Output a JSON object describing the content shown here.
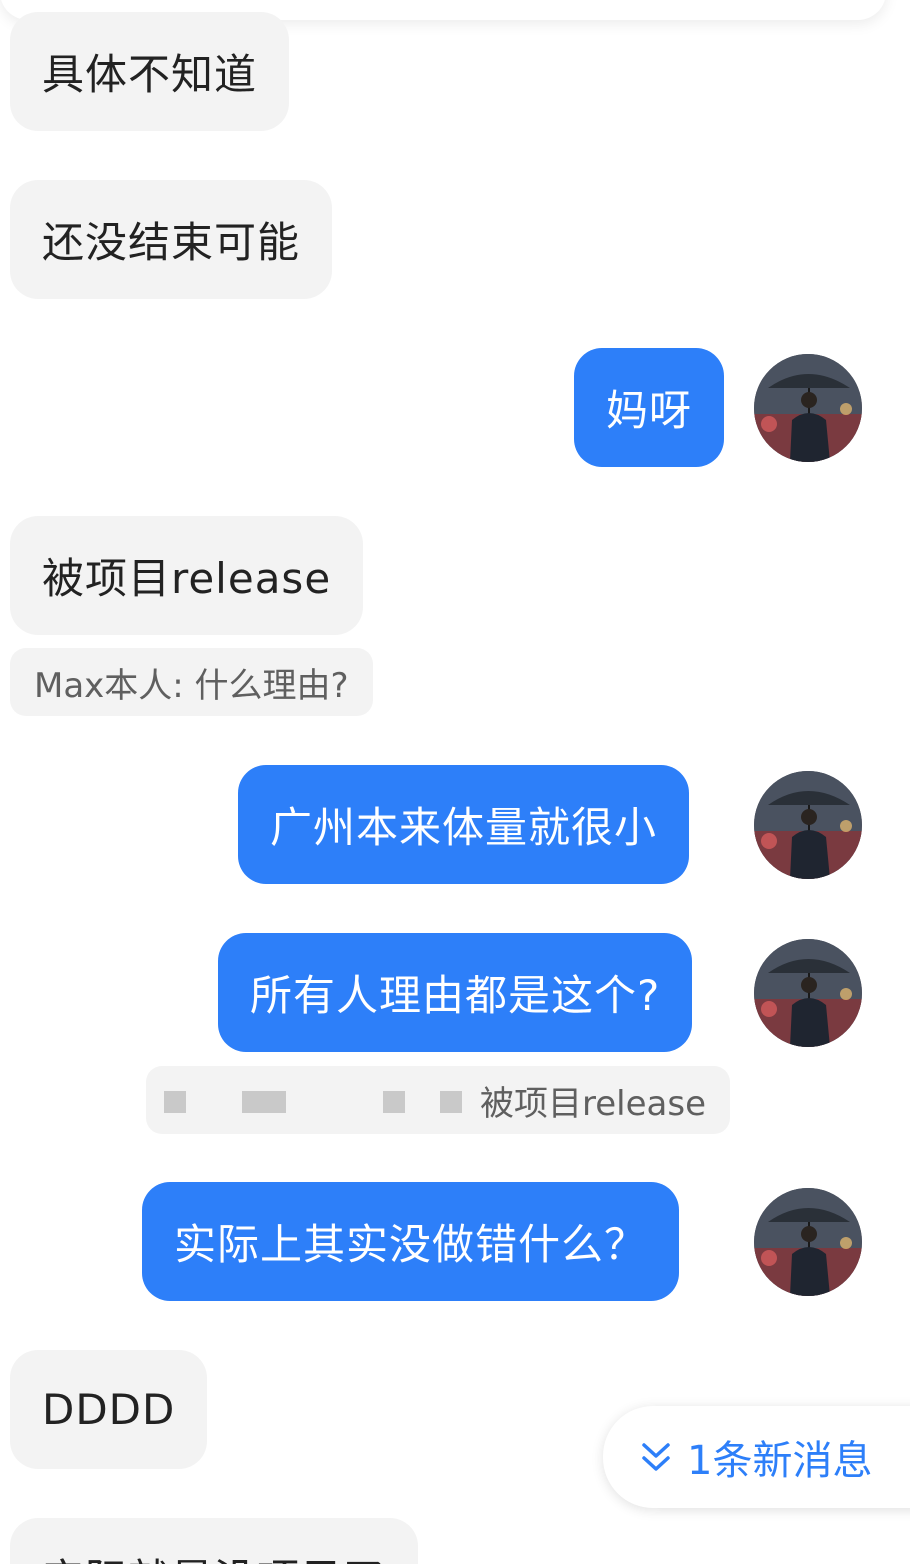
{
  "colors": {
    "sent_bubble": "#2d7ff9",
    "received_bubble": "#f3f3f3",
    "accent": "#2d7ff9"
  },
  "messages": [
    {
      "side": "left",
      "text": "具体不知道"
    },
    {
      "side": "left",
      "text": "还没结束可能"
    },
    {
      "side": "right",
      "text": "妈呀"
    },
    {
      "side": "left",
      "text": "被项目release"
    },
    {
      "quote": "Max本人: 什么理由?"
    },
    {
      "side": "right",
      "text": "广州本来体量就很小"
    },
    {
      "side": "right",
      "text": "所有人理由都是这个?"
    },
    {
      "quote": "被项目release"
    },
    {
      "side": "right",
      "text": "实际上其实没做错什么？"
    },
    {
      "side": "left",
      "text": "DDDD"
    },
    {
      "side": "left",
      "text": "实际就是没项目了"
    }
  ],
  "new_message_indicator": {
    "icon": "double-chevron-down-icon",
    "label": "1条新消息"
  }
}
